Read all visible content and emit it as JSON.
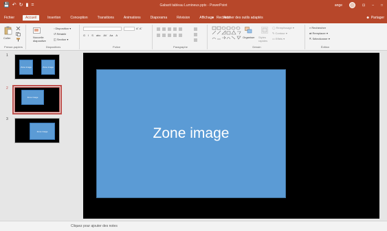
{
  "quick_access": {
    "save_icon": "save-icon",
    "undo_icon": "undo-icon",
    "redo_icon": "redo-icon",
    "start_icon": "start-slideshow-icon",
    "customize": "="
  },
  "window": {
    "title": "Gabarit tableau Lumineux.pptx - PowerPoint",
    "user": "ange",
    "ribbon_opts": "⊡",
    "minimize": "–",
    "maximize": "□"
  },
  "tabs": [
    "Fichier",
    "Accueil",
    "Insertion",
    "Conception",
    "Transitions",
    "Animations",
    "Diaporama",
    "Révision",
    "Affichage",
    "Aide"
  ],
  "active_tab": "Accueil",
  "tell_me": {
    "icon": "lightbulb-icon",
    "text": "Rechercher des outils adaptés"
  },
  "share": {
    "icon": "person-icon",
    "label": "Partager"
  },
  "ribbon": {
    "clipboard": {
      "paste_label": "Coller",
      "label": "Presse-papiers"
    },
    "slides": {
      "new_slide_label": "Nouvelle diapositive",
      "layout_label": "Disposition",
      "reset_label": "Rétablir",
      "section_label": "Section",
      "label": "Diapositives"
    },
    "font": {
      "label": "Police",
      "buttons": [
        "G",
        "I",
        "S",
        "abc",
        "AV",
        "Aa",
        "A"
      ]
    },
    "paragraph": {
      "label": "Paragraphe"
    },
    "drawing": {
      "arrange_label": "Organiser",
      "styles_label": "Styles rapides",
      "fill_label": "Remplissage",
      "outline_label": "Contour",
      "effects_label": "Effets",
      "label": "Dessin"
    },
    "editing": {
      "find_label": "Rechercher",
      "replace_label": "Remplacer",
      "select_label": "Sélectionner",
      "label": "Édition"
    }
  },
  "slides": [
    {
      "number": "1",
      "boxes": [
        "Zone image",
        "Zone image"
      ]
    },
    {
      "number": "2",
      "boxes": [
        "Zone image"
      ]
    },
    {
      "number": "3",
      "boxes": [
        "Zone image"
      ]
    }
  ],
  "selected_slide": "2",
  "main_slide": {
    "placeholder_text": "Zone image"
  },
  "notes": {
    "placeholder": "Cliquez pour ajouter des notes"
  },
  "colors": {
    "accent": "#b7472a",
    "slide_bg": "#000000",
    "placeholder_fill": "#5b9bd5",
    "selection": "#c0504d"
  }
}
